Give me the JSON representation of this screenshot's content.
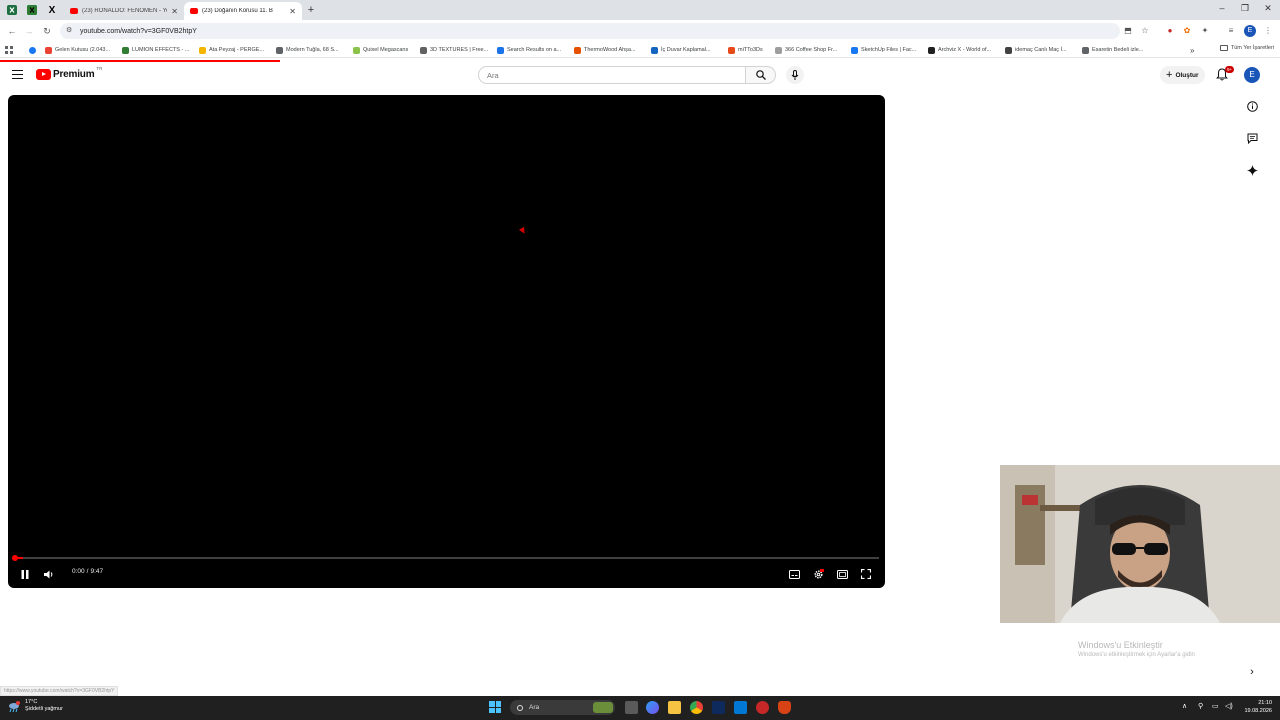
{
  "browser": {
    "tabs": [
      {
        "title": "(23) RONALDO: FENOMEN - Yo",
        "active": false
      },
      {
        "title": "(23) Doğanın Korusu 11. B",
        "active": true
      }
    ],
    "url": "youtube.com/watch?v=3GF0VB2htpY",
    "profile_initial": "E",
    "bookmarks": [
      {
        "label": "Gelen Kutusu (2.043...",
        "color": "#ea4335"
      },
      {
        "label": "LUMION EFFECTS - ...",
        "color": "#2e7d32"
      },
      {
        "label": "Ata Peyzaj - PERGE...",
        "color": "#f4b400"
      },
      {
        "label": "Modern Tuğla, 68 S...",
        "color": "#5f6368"
      },
      {
        "label": "Quixel Megascans",
        "color": "#8bc34a"
      },
      {
        "label": "3D TEXTURES | Free...",
        "color": "#616161"
      },
      {
        "label": "Search Results on a...",
        "color": "#1a73e8"
      },
      {
        "label": "ThermoWood Ahşa...",
        "color": "#e65100"
      },
      {
        "label": "İç Duvar Kaplamal...",
        "color": "#1565c0"
      },
      {
        "label": "miTTo3Ds",
        "color": "#e64a19"
      },
      {
        "label": "366 Coffee Shop Fr...",
        "color": "#9e9e9e"
      },
      {
        "label": "SketchUp Files | Fac...",
        "color": "#1877f2"
      },
      {
        "label": "Archviz X - World of...",
        "color": "#212121"
      },
      {
        "label": "idemaç Canlı Maç İ...",
        "color": "#424242"
      },
      {
        "label": "Esaretin Bedeli izle...",
        "color": "#5f6368"
      }
    ],
    "all_bookmarks_label": "Tüm Yer İşaretleri",
    "status_url": "https://www.youtube.com/watch?v=3GF0VB2htpY"
  },
  "youtube": {
    "logo_text": "Premium",
    "logo_country": "TR",
    "search_placeholder": "Ara",
    "create_label": "Oluştur",
    "notification_count": "9+",
    "avatar_initial": "E"
  },
  "player": {
    "current_time": "0:00",
    "time_separator": "/",
    "duration": "9:47",
    "progress_fraction": 0.01
  },
  "overlay": {
    "activate_title": "Windows'u Etkinleştir",
    "activate_sub": "Windows'u etkinleştirmek için Ayarlar'a gidin"
  },
  "taskbar": {
    "search_placeholder": "Ara",
    "weather_temp": "17°C",
    "weather_desc": "Şiddetli yağmur",
    "time": "21:10",
    "date": "19.08.2026"
  },
  "colors": {
    "youtube_red": "#ff0000",
    "taskbar_bg": "#202020",
    "avatar_blue": "#1a56b8"
  }
}
